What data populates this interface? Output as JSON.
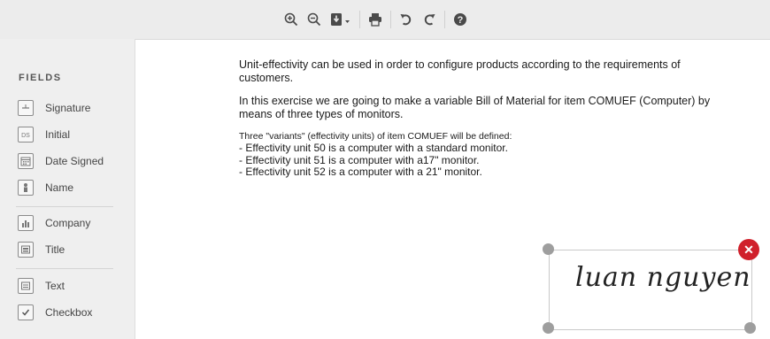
{
  "toolbar": {
    "buttons": [
      {
        "name": "zoom-in-icon"
      },
      {
        "name": "zoom-out-icon"
      },
      {
        "name": "download-icon"
      },
      {
        "name": "print-icon"
      },
      {
        "name": "undo-icon"
      },
      {
        "name": "redo-icon"
      },
      {
        "name": "help-icon"
      }
    ]
  },
  "sidebar": {
    "heading": "FIELDS",
    "items": [
      {
        "label": "Signature",
        "icon": "signature-icon"
      },
      {
        "label": "Initial",
        "icon": "initial-icon"
      },
      {
        "label": "Date Signed",
        "icon": "calendar-icon"
      },
      {
        "label": "Name",
        "icon": "person-icon"
      },
      {
        "label": "Company",
        "icon": "building-icon"
      },
      {
        "label": "Title",
        "icon": "id-card-icon"
      },
      {
        "label": "Text",
        "icon": "text-field-icon"
      },
      {
        "label": "Checkbox",
        "icon": "checkbox-icon"
      }
    ]
  },
  "document": {
    "p1": "Unit-effectivity can be used in order to configure products according to the requirements of customers.",
    "p2": "In this exercise we are going to make a variable Bill of Material for item COMUEF (Computer) by means of three types of monitors.",
    "p3": "Three \"variants\" (effectivity units) of item COMUEF will be defined:",
    "list": [
      "- Effectivity unit 50 is a computer with a standard monitor.",
      "- Effectivity unit 51 is a computer with a17\" monitor.",
      "- Effectivity unit 52 is a computer with a 21\" monitor."
    ]
  },
  "signature": {
    "text": "luan nguyen",
    "close_label": "✕",
    "accent": "#d0202b"
  }
}
